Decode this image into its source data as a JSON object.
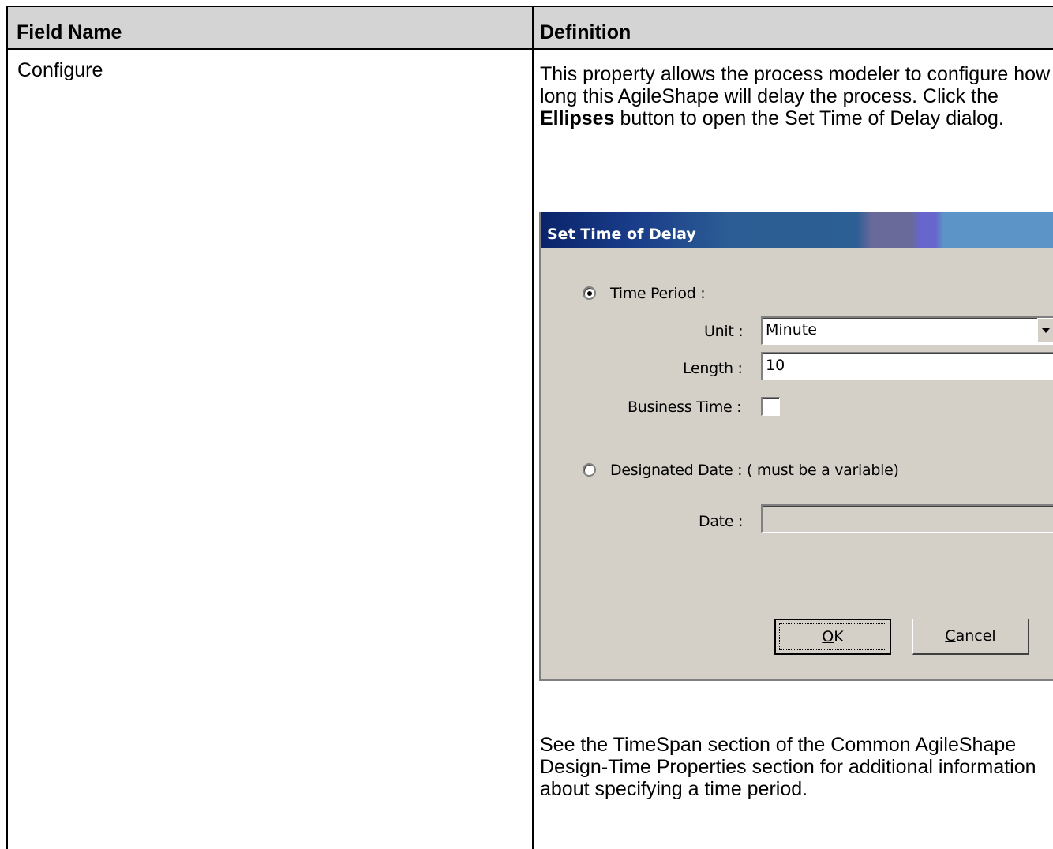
{
  "table": {
    "headers": {
      "field_name": "Field Name",
      "definition": "Definition"
    },
    "row": {
      "field_name": "Configure",
      "intro_before": "This property allows the process modeler to configure how long this AgileShape will delay the process. Click the ",
      "intro_bold": "Ellipses",
      "intro_after": " button to open the Set Time of Delay dialog.",
      "footer": "See the TimeSpan section of the Common AgileShape Design-Time Properties section for additional information about specifying a time period."
    }
  },
  "dialog": {
    "title": "Set Time of Delay",
    "time_period": {
      "label": "Time Period :",
      "selected": true
    },
    "unit": {
      "label": "Unit :",
      "value": "Minute"
    },
    "length": {
      "label": "Length :",
      "value": "10"
    },
    "business_time": {
      "label": "Business Time :",
      "checked": false
    },
    "designated_date": {
      "label": "Designated Date : ( must be a  variable)",
      "selected": false
    },
    "date": {
      "label": "Date :",
      "value": ""
    },
    "ok_button": {
      "mnemonic": "O",
      "rest": "K"
    },
    "cancel_button": {
      "mnemonic": "C",
      "rest": "ancel"
    }
  }
}
